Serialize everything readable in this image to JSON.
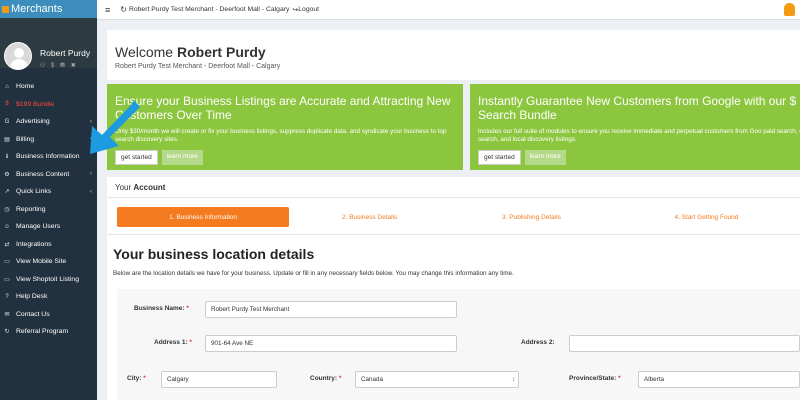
{
  "app": {
    "brand": "Merchants"
  },
  "user": {
    "name": "Robert Purdy",
    "icons": "⚇ $ ⛃ ✖"
  },
  "sidebar": {
    "items": [
      {
        "label": "Home",
        "icon": "⌂"
      },
      {
        "label": "$199 Bundle",
        "icon": "$"
      },
      {
        "label": "Advertising",
        "icon": "G",
        "chevron": "‹"
      },
      {
        "label": "Billing",
        "icon": "▤",
        "chevron": "‹"
      },
      {
        "label": "Business Information",
        "icon": "ℹ"
      },
      {
        "label": "Business Content",
        "icon": "⚙",
        "chevron": "‹"
      },
      {
        "label": "Quick Links",
        "icon": "↗",
        "chevron": "‹"
      },
      {
        "label": "Reporting",
        "icon": "◷"
      },
      {
        "label": "Manage Users",
        "icon": "☺"
      },
      {
        "label": "Integrations",
        "icon": "⇄"
      },
      {
        "label": "View Mobile Site",
        "icon": "▭"
      },
      {
        "label": "View Shoptoit Listing",
        "icon": "▭"
      },
      {
        "label": "Help Desk",
        "icon": "?"
      },
      {
        "label": "Contact Us",
        "icon": "✉"
      },
      {
        "label": "Referral Program",
        "icon": "↻"
      }
    ]
  },
  "topbar": {
    "menu_icon": "≡",
    "refresh_icon": "↻",
    "merchant": "Robert Purdy Test Merchant - Deerfoot Mall - Calgary",
    "logout_icon": "↪",
    "logout": "Logout"
  },
  "welcome": {
    "prefix": "Welcome ",
    "name": "Robert Purdy",
    "subtitle": "Robert Purdy Test Merchant - Deerfoot Mall - Calgary"
  },
  "promos": [
    {
      "title": "Ensure your Business Listings are Accurate and Attracting New Customers Over Time",
      "text": "Only $30/month we will create or fix your business listings, suppress duplicate data, and syndicate your business to top search discovery sites.",
      "start": "get started",
      "more": "learn more"
    },
    {
      "title": "Instantly Guarantee New Customers from Google with our $ Search Bundle",
      "text": "Includes our full suite of modules to ensure you receive immediate and perpetual customers from Goo paid search, organic search, and local discovery listings.",
      "start": "get started",
      "more": "learn more"
    }
  ],
  "account": {
    "title_prefix": "Your ",
    "title_bold": "Account",
    "steps": [
      "1. Business Information",
      "2. Business Details",
      "3. Publishing Details",
      "4. Start Getting Found"
    ],
    "heading": "Your business location details",
    "description": "Below are the location details we have for your business. Update or fill in any necessary fields below. You may change this information any time."
  },
  "form": {
    "business_name": {
      "label": "Business Name:",
      "value": "Robert Purdy Test Merchant"
    },
    "address1": {
      "label": "Address 1:",
      "value": "901-64 Ave NE"
    },
    "address2": {
      "label": "Address 2:",
      "value": ""
    },
    "city": {
      "label": "City:",
      "value": "Calgary"
    },
    "country": {
      "label": "Country:",
      "value": "Canada"
    },
    "province": {
      "label": "Province/State:",
      "value": "Alberta"
    },
    "required_mark": "*"
  },
  "colors": {
    "sidebar": "#22313f",
    "brand_bar": "#3c8dbc",
    "promo_green": "#8cc63f",
    "step_orange": "#f47b20",
    "arrow_blue": "#1e9be0"
  }
}
